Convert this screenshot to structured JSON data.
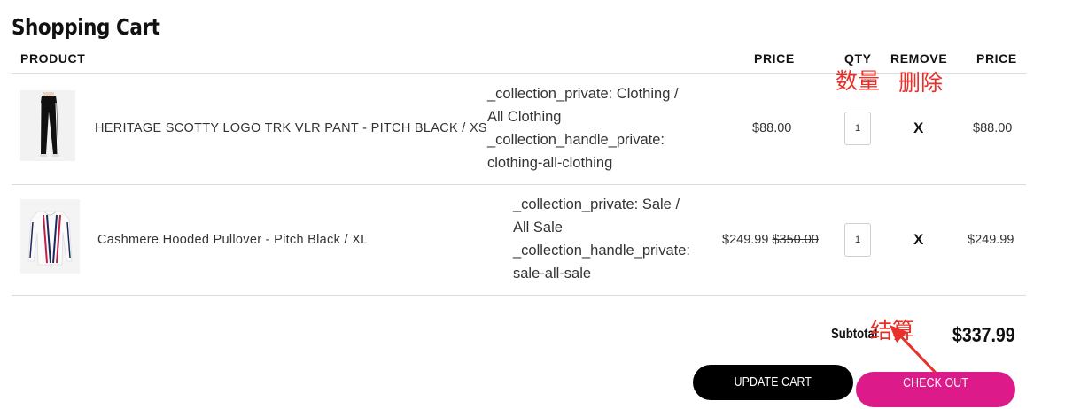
{
  "page": {
    "title": "Shopping Cart"
  },
  "table": {
    "headers": {
      "product": "PRODUCT",
      "price": "PRICE",
      "qty": "QTY",
      "remove": "REMOVE",
      "total": "PRICE"
    }
  },
  "items": [
    {
      "name": "HERITAGE SCOTTY LOGO TRK VLR PANT - PITCH BLACK / XS",
      "props": [
        "_collection_private: Clothing /",
        "All Clothing",
        "_collection_handle_private:",
        "clothing-all-clothing"
      ],
      "price": "$88.00",
      "compare_price": "",
      "qty": "1",
      "remove": "X",
      "line_price": "$88.00"
    },
    {
      "name": "Cashmere Hooded Pullover - Pitch Black / XL",
      "props": [
        "_collection_private: Sale /",
        "All Sale",
        "_collection_handle_private:",
        "sale-all-sale"
      ],
      "price": "$249.99",
      "compare_price": "$350.00",
      "qty": "1",
      "remove": "X",
      "line_price": "$249.99"
    }
  ],
  "summary": {
    "subtotal_label": "Subtotal",
    "subtotal_value": "$337.99"
  },
  "buttons": {
    "update_cart": "UPDATE CART",
    "checkout": "CHECK OUT"
  },
  "annotations": {
    "qty": "数量",
    "remove": "删除",
    "checkout": "结算"
  },
  "colors": {
    "checkout_button": "#dc1a89",
    "update_button": "#000000",
    "annotation": "#e8302a"
  }
}
